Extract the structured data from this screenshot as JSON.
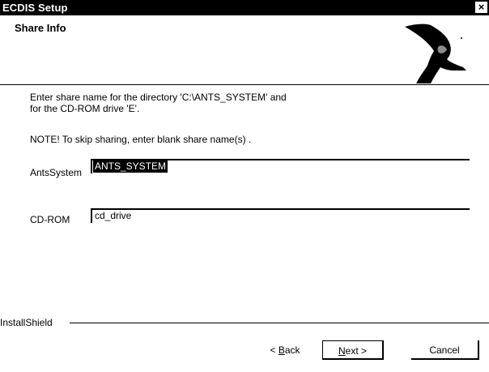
{
  "window": {
    "title": "ECDIS Setup",
    "close_glyph": "×"
  },
  "header": {
    "title": "Share Info",
    "graphic_icon": "installshield-wizard-graphic"
  },
  "content": {
    "description_line1": "Enter share name for the directory 'C:\\ANTS_SYSTEM' and",
    "description_line2": "for the CD-ROM drive 'E'.",
    "note": "NOTE! To skip sharing, enter blank share name(s) ."
  },
  "fields": {
    "antssystem_label": "AntsSystem",
    "antssystem_value": "ANTS_SYSTEM",
    "cdrom_label": "CD-ROM",
    "cdrom_value": "cd_drive"
  },
  "footer": {
    "brand": "InstallShield"
  },
  "buttons": {
    "back_prefix": "< ",
    "back_mnemonic": "B",
    "back_rest": "ack",
    "next_mnemonic": "N",
    "next_rest": "ext >",
    "cancel": "Cancel"
  }
}
